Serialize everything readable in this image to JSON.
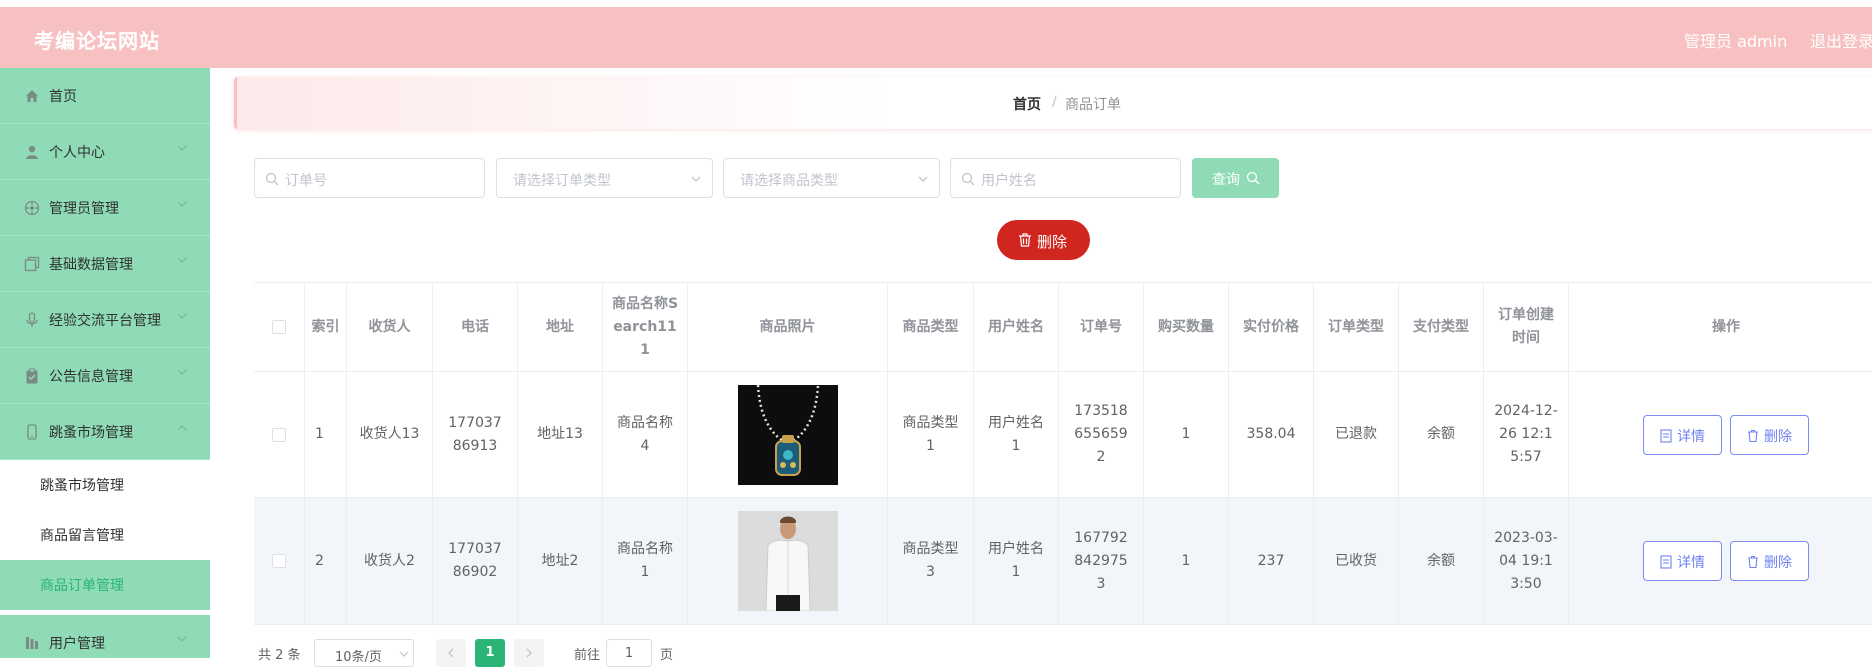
{
  "header": {
    "site_title": "考编论坛网站",
    "admin_label": "管理员 admin",
    "logout": "退出登录"
  },
  "sidebar": {
    "items": [
      {
        "label": "首页",
        "icon": "home-icon"
      },
      {
        "label": "个人中心",
        "icon": "user-icon"
      },
      {
        "label": "管理员管理",
        "icon": "admin-icon"
      },
      {
        "label": "基础数据管理",
        "icon": "copy-icon"
      },
      {
        "label": "经验交流平台管理",
        "icon": "microphone-icon"
      },
      {
        "label": "公告信息管理",
        "icon": "clipboard-icon"
      },
      {
        "label": "跳蚤市场管理",
        "icon": "phone-icon"
      },
      {
        "label": "用户管理",
        "icon": "bar-icon"
      }
    ],
    "subitems": [
      {
        "label": "跳蚤市场管理"
      },
      {
        "label": "商品留言管理"
      },
      {
        "label": "商品订单管理"
      }
    ]
  },
  "breadcrumb": {
    "home": "首页",
    "separator": "/",
    "current": "商品订单"
  },
  "search": {
    "order_no_placeholder": "订单号",
    "order_type_placeholder": "请选择订单类型",
    "goods_type_placeholder": "请选择商品类型",
    "user_name_placeholder": "用户姓名",
    "query_label": "查询"
  },
  "delete_label": "删除",
  "table": {
    "headers": [
      "索引",
      "收货人",
      "电话",
      "地址",
      "商品名称Search111",
      "商品照片",
      "商品类型",
      "用户姓名",
      "订单号",
      "购买数量",
      "实付价格",
      "订单类型",
      "支付类型",
      "订单创建时间",
      "操作"
    ],
    "rows": [
      {
        "index": "1",
        "receiver": "收货人13",
        "phone": "17703786913",
        "address": "地址13",
        "goods_name": "商品名称4",
        "goods_type": "商品类型1",
        "user_name": "用户姓名1",
        "order_no": "1735186556592",
        "quantity": "1",
        "price": "358.04",
        "order_type": "已退款",
        "pay_type": "余额",
        "created": "2024-12-26 12:15:57",
        "photo": "necklace"
      },
      {
        "index": "2",
        "receiver": "收货人2",
        "phone": "17703786902",
        "address": "地址2",
        "goods_name": "商品名称1",
        "goods_type": "商品类型3",
        "user_name": "用户姓名1",
        "order_no": "1677928429753",
        "quantity": "1",
        "price": "237",
        "order_type": "已收货",
        "pay_type": "余额",
        "created": "2023-03-04 19:13:50",
        "photo": "white-shirt-man"
      }
    ],
    "detail_label": "详情",
    "delete_label": "删除"
  },
  "pagination": {
    "total": "共 2 条",
    "page_size": "10条/页",
    "current_page": "1",
    "goto": "前往",
    "goto_value": "1",
    "page_suffix": "页"
  },
  "colors": {
    "header": "#f7c1c1",
    "menu": "#8fdbb5",
    "accent": "#2ab577",
    "danger": "#d0261f",
    "primary": "#6f82f4"
  }
}
